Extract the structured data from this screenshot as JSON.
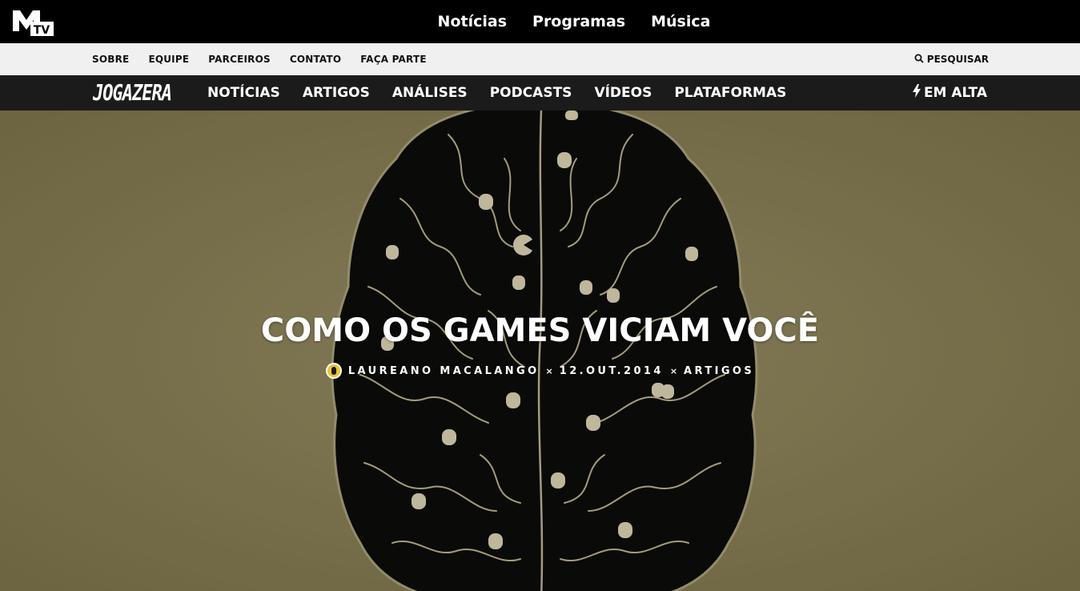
{
  "mtv": {
    "logo_label": "MTV",
    "nav": [
      "Notícias",
      "Programas",
      "Música"
    ]
  },
  "subnav": {
    "items": [
      "SOBRE",
      "EQUIPE",
      "PARCEIROS",
      "CONTATO",
      "FAÇA PARTE"
    ],
    "search_label": "PESQUISAR",
    "search_icon": "search-icon"
  },
  "jogazera": {
    "logo": "JOGAZERA",
    "nav": [
      "NOTÍCIAS",
      "ARTIGOS",
      "ANÁLISES",
      "PODCASTS",
      "VÍDEOS",
      "PLATAFORMAS"
    ],
    "trending_label": "EM ALTA",
    "trending_icon": "lightning-icon"
  },
  "hero": {
    "title": "COMO OS GAMES VICIAM VOCÊ",
    "author": "LAUREANO MACALANGO",
    "separator": "×",
    "date": "12.OUT.2014",
    "category": "ARTIGOS",
    "background_color": "#8f8559"
  }
}
